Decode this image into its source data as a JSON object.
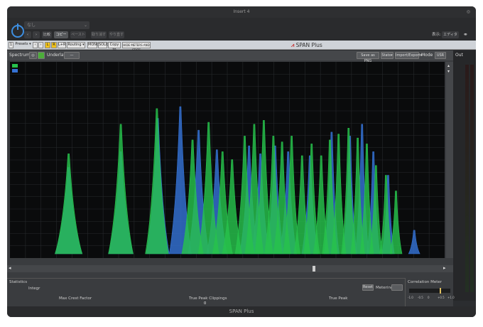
{
  "window": {
    "title": "Insert 4"
  },
  "host": {
    "preset": "なし",
    "compare": "比較",
    "copy": "コピー",
    "paste": "ペースト",
    "undo": "取り消す",
    "redo": "やり直す",
    "view_label": "表示:",
    "view_value": "エディタ"
  },
  "plugin": {
    "presets": "Presets",
    "routing": "Routing",
    "mono": "MONO",
    "solo": "SOLO",
    "copy_to": "Copy to",
    "hide_meters": "HIDE METERS AND STATS",
    "brand": "SPAN Plus",
    "channel_l": "L",
    "channel_r": "R",
    "channel_lr": "L+R",
    "preset_num": "1"
  },
  "spectrum": {
    "label": "Spectrum",
    "underlay": "Underlay",
    "save_png": "Save as PNG",
    "stats": "Stats",
    "import_export": "Import/Export",
    "mode": "Mode",
    "mode_value": "USR",
    "legend": [
      {
        "name": "",
        "color": "#27c24c"
      },
      {
        "name": "",
        "color": "#3572d4"
      }
    ],
    "freq_ticks": [
      "",
      "",
      "",
      "",
      "",
      "",
      "",
      "",
      "",
      "",
      "",
      "",
      "",
      "",
      "",
      "",
      "",
      "",
      "",
      "",
      "",
      "",
      "",
      "",
      "",
      "",
      "",
      "",
      ""
    ],
    "db_ticks": [
      "",
      "",
      "",
      "",
      "",
      "",
      "",
      "",
      "",
      "",
      "",
      "",
      "",
      "",
      "",
      "",
      "",
      "",
      "",
      ""
    ]
  },
  "statistics": {
    "label": "Statistics",
    "integr_label": "Integr",
    "integr_value": "",
    "reset": "Reset",
    "metering": "Metering",
    "metering_value": "",
    "max_crest_label": "Max Crest Factor",
    "max_crest_value": "",
    "tp_clip_label": "True Peak Clippings",
    "tp_clip_value": "0",
    "true_peak_label": "True Peak",
    "true_peak_value": ""
  },
  "correlation": {
    "label": "Correlation Meter",
    "ticks": [
      "-1.0",
      "-0.5",
      "0",
      "+0.5",
      "+1.0"
    ]
  },
  "output": {
    "label": "Out"
  },
  "footer": {
    "title": "SPAN Plus"
  },
  "chart_data": {
    "type": "area",
    "xlabel": "",
    "ylabel": "",
    "grid": true,
    "series": [
      {
        "name": "",
        "color": "#27c24c",
        "peaks": [
          [
            0.135,
            0.51
          ],
          [
            0.255,
            0.66
          ],
          [
            0.338,
            0.74
          ],
          [
            0.42,
            0.58
          ],
          [
            0.457,
            0.67
          ],
          [
            0.489,
            0.52
          ],
          [
            0.511,
            0.48
          ],
          [
            0.54,
            0.6
          ],
          [
            0.562,
            0.66
          ],
          [
            0.584,
            0.68
          ],
          [
            0.606,
            0.6
          ],
          [
            0.626,
            0.57
          ],
          [
            0.648,
            0.6
          ],
          [
            0.672,
            0.5
          ],
          [
            0.694,
            0.56
          ],
          [
            0.716,
            0.5
          ],
          [
            0.736,
            0.58
          ],
          [
            0.756,
            0.61
          ],
          [
            0.779,
            0.64
          ],
          [
            0.8,
            0.59
          ],
          [
            0.821,
            0.56
          ],
          [
            0.842,
            0.45
          ],
          [
            0.865,
            0.4
          ],
          [
            0.888,
            0.32
          ]
        ]
      },
      {
        "name": "",
        "color": "#3572d4",
        "peaks": [
          [
            0.135,
            0.44
          ],
          [
            0.255,
            0.52
          ],
          [
            0.34,
            0.69
          ],
          [
            0.392,
            0.75
          ],
          [
            0.434,
            0.63
          ],
          [
            0.476,
            0.53
          ],
          [
            0.55,
            0.55
          ],
          [
            0.576,
            0.51
          ],
          [
            0.61,
            0.55
          ],
          [
            0.64,
            0.52
          ],
          [
            0.69,
            0.5
          ],
          [
            0.74,
            0.62
          ],
          [
            0.782,
            0.6
          ],
          [
            0.81,
            0.66
          ],
          [
            0.836,
            0.52
          ],
          [
            0.87,
            0.4
          ],
          [
            0.93,
            0.12
          ]
        ]
      }
    ]
  }
}
